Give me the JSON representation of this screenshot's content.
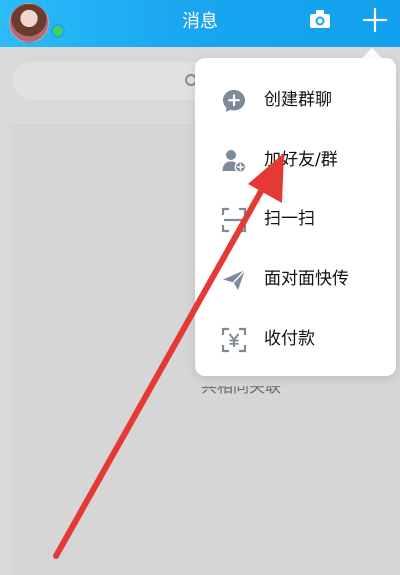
{
  "header": {
    "title": "消息",
    "bg_color": "#1aa6f1"
  },
  "menu": {
    "items": [
      {
        "label": "创建群聊",
        "icon": "chat-plus-icon"
      },
      {
        "label": "加好友/群",
        "icon": "add-friend-icon"
      },
      {
        "label": "扫一扫",
        "icon": "scan-icon"
      },
      {
        "label": "面对面快传",
        "icon": "send-icon"
      },
      {
        "label": "收付款",
        "icon": "payment-icon"
      }
    ]
  },
  "icons": {
    "camera": "camera-icon",
    "plus": "plus-icon",
    "search": "search-icon"
  },
  "background": {
    "peek_text": "共相同关联"
  },
  "annotation": {
    "arrow_color": "#e53935"
  }
}
